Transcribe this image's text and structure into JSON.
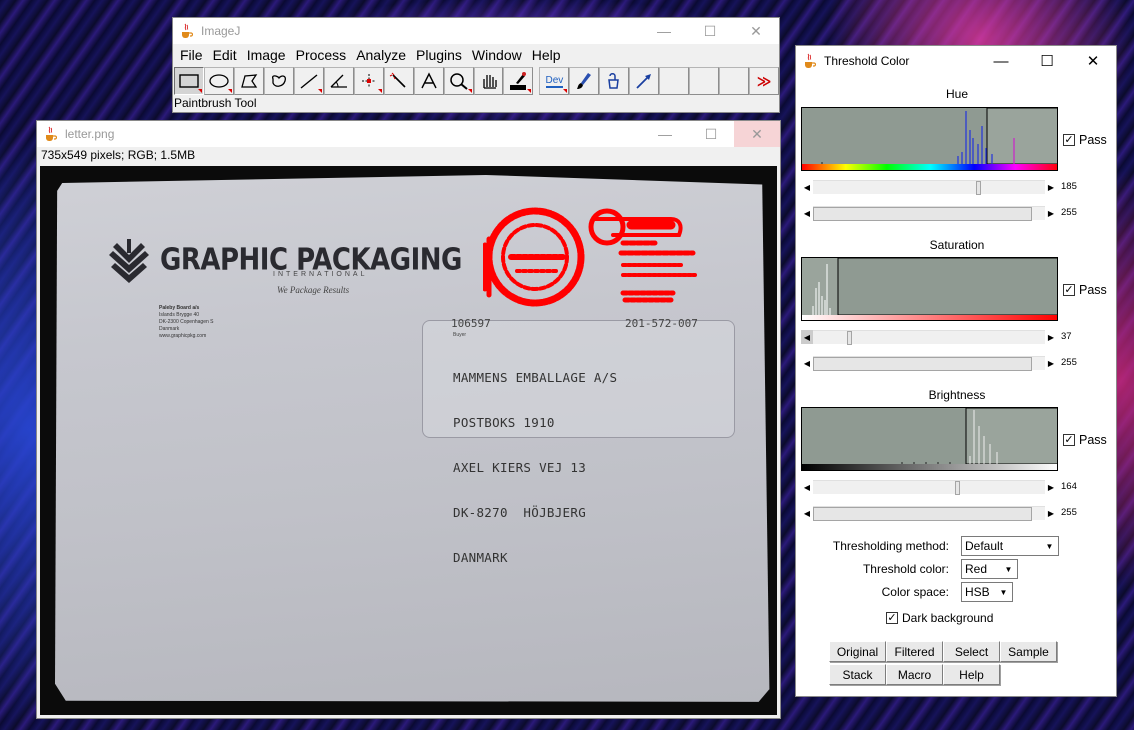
{
  "imagej": {
    "title": "ImageJ",
    "menu": [
      "File",
      "Edit",
      "Image",
      "Process",
      "Analyze",
      "Plugins",
      "Window",
      "Help"
    ],
    "tools": [
      "rectangle-tool",
      "oval-tool",
      "polygon-tool",
      "freehand-tool",
      "line-tool",
      "angle-tool",
      "point-tool",
      "wand-tool",
      "text-tool",
      "magnifier-tool",
      "hand-tool",
      "color-picker-tool",
      "dev-tool",
      "paintbrush-tool",
      "flood-fill-tool",
      "arrow-tool",
      "more-tools"
    ],
    "dev_label": "Dev",
    "more_label": "≫",
    "status": "Paintbrush Tool"
  },
  "image_window": {
    "title": "letter.png",
    "info": "735x549 pixels; RGB; 1.5MB",
    "envelope": {
      "company": "GRAPHIC PACKAGING",
      "company_sub": "INTERNATIONAL",
      "tagline": "We Package Results",
      "sender_lines": [
        "Paleby Board a/s",
        "Islands Brygge 40",
        "DK-2300 Copenhagen S",
        "Danmark",
        "www.graphicpkg.com"
      ],
      "ref_left": "106597",
      "ref_right": "201-572-007",
      "buyer_label": "Buyer",
      "address": [
        "MAMMENS EMBALLAGE A/S",
        "POSTBOKS 1910",
        "AXEL KIERS VEJ 13",
        "DK-8270  HÖJBJERG",
        "DANMARK"
      ]
    }
  },
  "threshold": {
    "title": "Threshold Color",
    "sections": [
      {
        "label": "Hue",
        "pass": "Pass",
        "min": "185",
        "max": "255"
      },
      {
        "label": "Saturation",
        "pass": "Pass",
        "min": "37",
        "max": "255"
      },
      {
        "label": "Brightness",
        "pass": "Pass",
        "min": "164",
        "max": "255"
      }
    ],
    "method_label": "Thresholding method:",
    "method_value": "Default",
    "color_label": "Threshold color:",
    "color_value": "Red",
    "space_label": "Color space:",
    "space_value": "HSB",
    "dark_bg_label": "Dark background",
    "buttons": [
      "Original",
      "Filtered",
      "Select",
      "Sample",
      "Stack",
      "Macro",
      "Help"
    ]
  },
  "colors": {
    "threshold_red": "#ff0000",
    "histogram_bg": "#8f9a92",
    "hue_bars": "#2233dd",
    "hue_purple": "#cc22cc"
  }
}
